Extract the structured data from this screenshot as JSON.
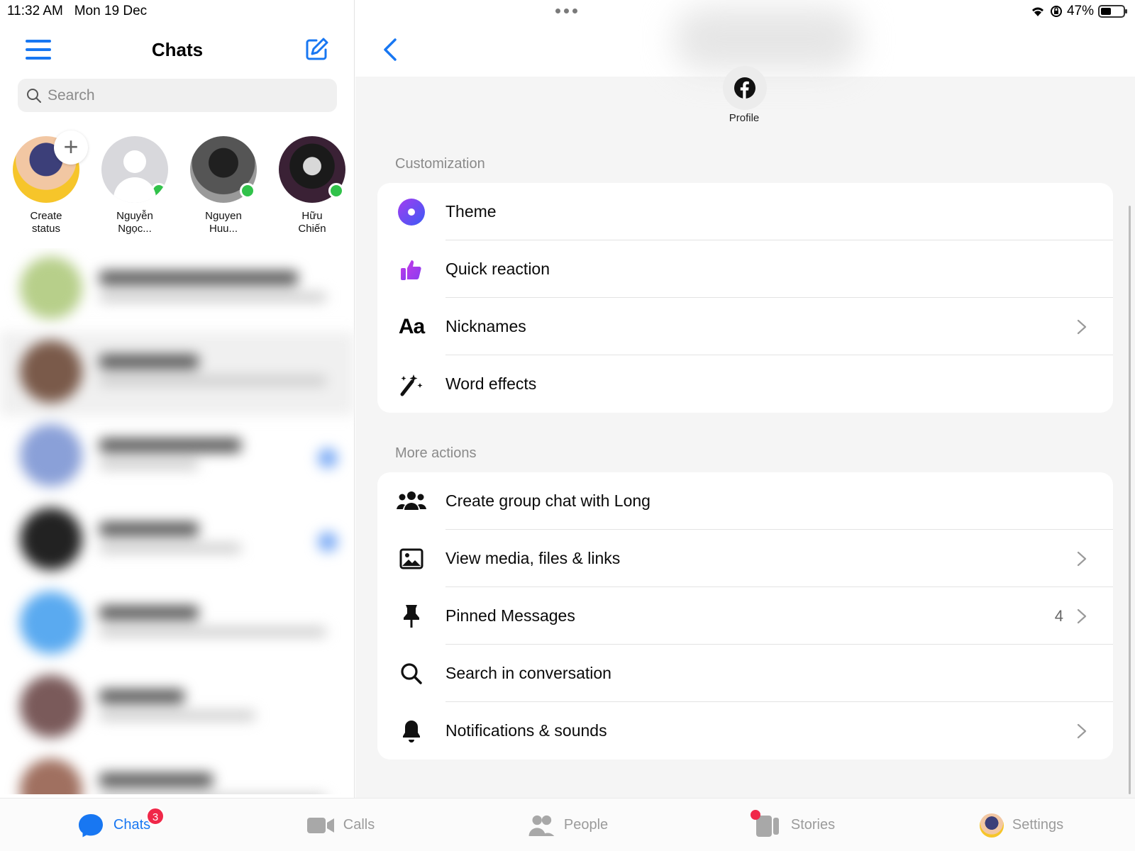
{
  "status_bar": {
    "time": "11:32 AM",
    "date": "Mon 19 Dec",
    "battery": "47%"
  },
  "left": {
    "title": "Chats",
    "search_placeholder": "Search",
    "stories": [
      {
        "name": "Create\nstatus"
      },
      {
        "name": "Nguyễn\nNgọc..."
      },
      {
        "name": "Nguyen\nHuu..."
      },
      {
        "name": "Hữu\nChiến"
      }
    ]
  },
  "right": {
    "profile_label": "Profile",
    "customization_label": "Customization",
    "customization_items": [
      {
        "label": "Theme",
        "icon": "theme-icon"
      },
      {
        "label": "Quick reaction",
        "icon": "thumbs-up-icon"
      },
      {
        "label": "Nicknames",
        "icon": "text-aa-icon"
      },
      {
        "label": "Word effects",
        "icon": "magic-wand-icon"
      }
    ],
    "more_actions_label": "More actions",
    "more_actions_items": [
      {
        "label": "Create group chat with Long",
        "icon": "group-icon"
      },
      {
        "label": "View media, files & links",
        "icon": "image-icon"
      },
      {
        "label": "Pinned Messages",
        "icon": "pin-icon",
        "count": "4"
      },
      {
        "label": "Search in conversation",
        "icon": "search-icon"
      },
      {
        "label": "Notifications & sounds",
        "icon": "bell-icon"
      }
    ]
  },
  "tabs": [
    {
      "label": "Chats",
      "badge": "3"
    },
    {
      "label": "Calls"
    },
    {
      "label": "People"
    },
    {
      "label": "Stories"
    },
    {
      "label": "Settings"
    }
  ],
  "colors": {
    "accent": "#1877f2",
    "online": "#31c24a",
    "badge": "#f02849"
  }
}
